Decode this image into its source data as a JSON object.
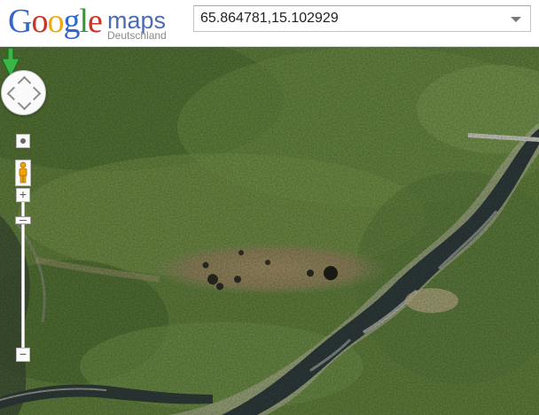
{
  "header": {
    "logo_primary": "Google",
    "logo_product": "maps",
    "logo_region": "Deutschland"
  },
  "search": {
    "value": "65.864781,15.102929"
  },
  "map": {
    "view": "satellite",
    "marker_color": "#39b54a"
  },
  "controls": {
    "zoom_in_label": "+",
    "zoom_out_label": "−"
  }
}
